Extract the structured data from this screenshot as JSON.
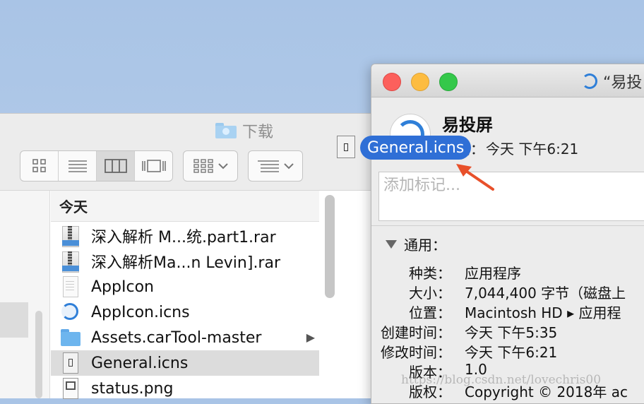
{
  "finder": {
    "title": "下载",
    "column_header": "今天",
    "files": [
      {
        "name": "深入解析 M...统.part1.rar",
        "icon": "rar-archive-icon"
      },
      {
        "name": "深入解析Ma...n Levin].rar",
        "icon": "rar-archive-icon"
      },
      {
        "name": "AppIcon",
        "icon": "document-icon"
      },
      {
        "name": "AppIcon.icns",
        "icon": "sync-icon"
      },
      {
        "name": "Assets.carTool-master",
        "icon": "folder-icon",
        "chevron": "▶"
      },
      {
        "name": "General.icns",
        "icon": "icns-icon",
        "selected": true
      },
      {
        "name": "status.png",
        "icon": "png-icon"
      }
    ]
  },
  "drag": {
    "label": "General.icns"
  },
  "info": {
    "window_title": "“易投",
    "app_name": "易投屏",
    "modified_label": "时间：",
    "modified_value": "今天 下午6:21",
    "tags_placeholder": "添加标记...",
    "general_header": "通用：",
    "rows": [
      {
        "key": "种类：",
        "value": "应用程序"
      },
      {
        "key": "大小：",
        "value": "7,044,400 字节（磁盘上"
      },
      {
        "key": "位置：",
        "value": "Macintosh HD ▸ 应用程"
      },
      {
        "key": "创建时间：",
        "value": "今天 下午5:35"
      },
      {
        "key": "修改时间：",
        "value": "今天 下午6:21"
      },
      {
        "key": "版本：",
        "value": "1.0"
      },
      {
        "key": "版权：",
        "value": "Copyright © 2018年 ac"
      }
    ]
  },
  "watermark": "https://blog.csdn.net/lovechris00",
  "colors": {
    "accent": "#2f6fd6",
    "close": "#fc605c",
    "minimize": "#fdbc40",
    "zoom": "#34c84a",
    "arrow": "#e8502a"
  }
}
